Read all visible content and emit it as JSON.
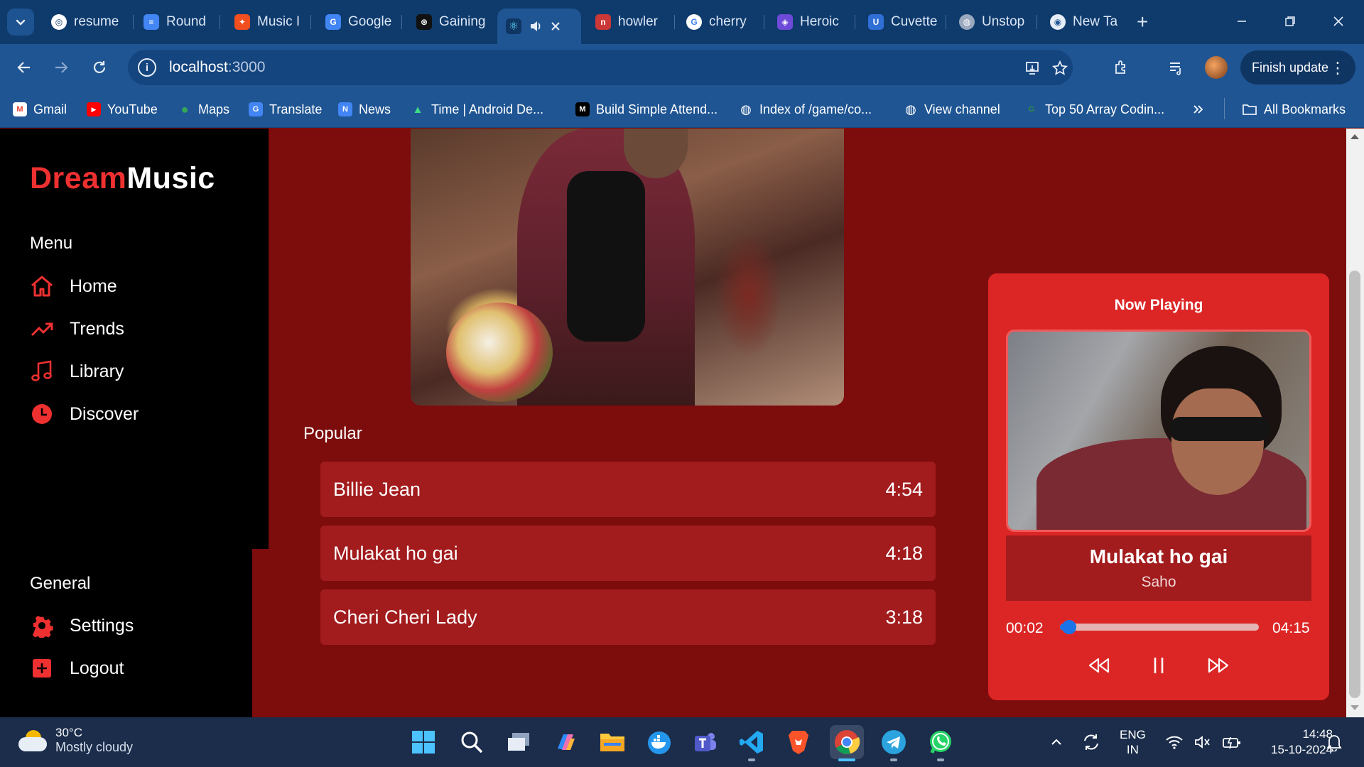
{
  "browser": {
    "tabs": [
      {
        "title": "resume",
        "favicon": "chatgpt-icon",
        "fav_color": "#0e3a6c",
        "fav_char": "◎"
      },
      {
        "title": "Round",
        "favicon": "docs-icon",
        "fav_color": "#4285f4",
        "fav_char": "≡"
      },
      {
        "title": "Music I",
        "favicon": "figma-icon",
        "fav_color": "#f24e1e",
        "fav_char": "✦"
      },
      {
        "title": "Google",
        "favicon": "google-translate-icon",
        "fav_color": "#4285f4",
        "fav_char": "G"
      },
      {
        "title": "Gaining",
        "favicon": "openai-icon",
        "fav_color": "#111111",
        "fav_char": "⊛"
      },
      {
        "title": "",
        "favicon": "react-icon",
        "fav_color": "#1f5593",
        "fav_char": "⚛"
      },
      {
        "title": "howler",
        "favicon": "npm-icon",
        "fav_color": "#cb3837",
        "fav_char": "n"
      },
      {
        "title": "cherry",
        "favicon": "google-icon",
        "fav_color": "#ffffff",
        "fav_char": "G"
      },
      {
        "title": "Heroic",
        "favicon": "shield-icon",
        "fav_color": "#6d4bd8",
        "fav_char": "◈"
      },
      {
        "title": "Cuvette",
        "favicon": "cuvette-icon",
        "fav_color": "#2f6fd6",
        "fav_char": "U"
      },
      {
        "title": "Unstop",
        "favicon": "globe-icon",
        "fav_color": "#9aa8bd",
        "fav_char": "◍"
      },
      {
        "title": "New Ta",
        "favicon": "chrome-icon",
        "fav_color": "#e6edf7",
        "fav_char": "◉"
      }
    ],
    "url_host": "localhost",
    "url_port": ":3000",
    "finish_update": "Finish update",
    "bookmarks": [
      {
        "label": "Gmail",
        "icon": "gmail-icon",
        "color": "#ea4335",
        "char": "M"
      },
      {
        "label": "YouTube",
        "icon": "youtube-icon",
        "color": "#ff0000",
        "char": "▶"
      },
      {
        "label": "Maps",
        "icon": "maps-icon",
        "color": "#34a853",
        "char": "●"
      },
      {
        "label": "Translate",
        "icon": "translate-icon",
        "color": "#4285f4",
        "char": "G"
      },
      {
        "label": "News",
        "icon": "news-icon",
        "color": "#4285f4",
        "char": "N"
      },
      {
        "label": "Time | Android De...",
        "icon": "android-icon",
        "color": "#3ddc84",
        "char": "▲"
      },
      {
        "label": "Build Simple Attend...",
        "icon": "medium-icon",
        "color": "#000000",
        "char": "M"
      },
      {
        "label": "Index of /game/co...",
        "icon": "globe-icon",
        "color": "#ffffff",
        "char": "◍"
      },
      {
        "label": "View channel",
        "icon": "globe-icon",
        "color": "#ffffff",
        "char": "◍"
      },
      {
        "label": "Top 50 Array Codin...",
        "icon": "gfg-icon",
        "color": "#2f8d46",
        "char": "G"
      }
    ],
    "all_bookmarks": "All Bookmarks"
  },
  "app": {
    "logo_dream": "Dream",
    "logo_music": "Music",
    "menu_title": "Menu",
    "menu": [
      {
        "label": "Home",
        "icon": "home-icon"
      },
      {
        "label": "Trends",
        "icon": "trending-icon"
      },
      {
        "label": "Library",
        "icon": "music-note-icon"
      },
      {
        "label": "Discover",
        "icon": "clock-icon"
      }
    ],
    "general_title": "General",
    "general": [
      {
        "label": "Settings",
        "icon": "gear-icon"
      },
      {
        "label": "Logout",
        "icon": "logout-icon"
      }
    ],
    "popular_title": "Popular",
    "songs": [
      {
        "title": "Billie Jean",
        "duration": "4:54"
      },
      {
        "title": "Mulakat ho gai",
        "duration": "4:18"
      },
      {
        "title": "Cheri Cheri Lady",
        "duration": "3:18"
      }
    ],
    "now_playing": {
      "heading": "Now Playing",
      "title": "Mulakat ho gai",
      "artist": "Saho",
      "elapsed": "00:02",
      "total": "04:15",
      "progress": 0.01
    },
    "colors": {
      "accent": "#ef3030",
      "card": "#dc2626",
      "row": "#a21b1d",
      "bg": "#7d0c0d",
      "progress": "#1a73e8"
    }
  },
  "taskbar": {
    "temp": "30°C",
    "weather": "Mostly cloudy",
    "lang_1": "ENG",
    "lang_2": "IN",
    "time": "14:48",
    "date": "15-10-2024"
  }
}
